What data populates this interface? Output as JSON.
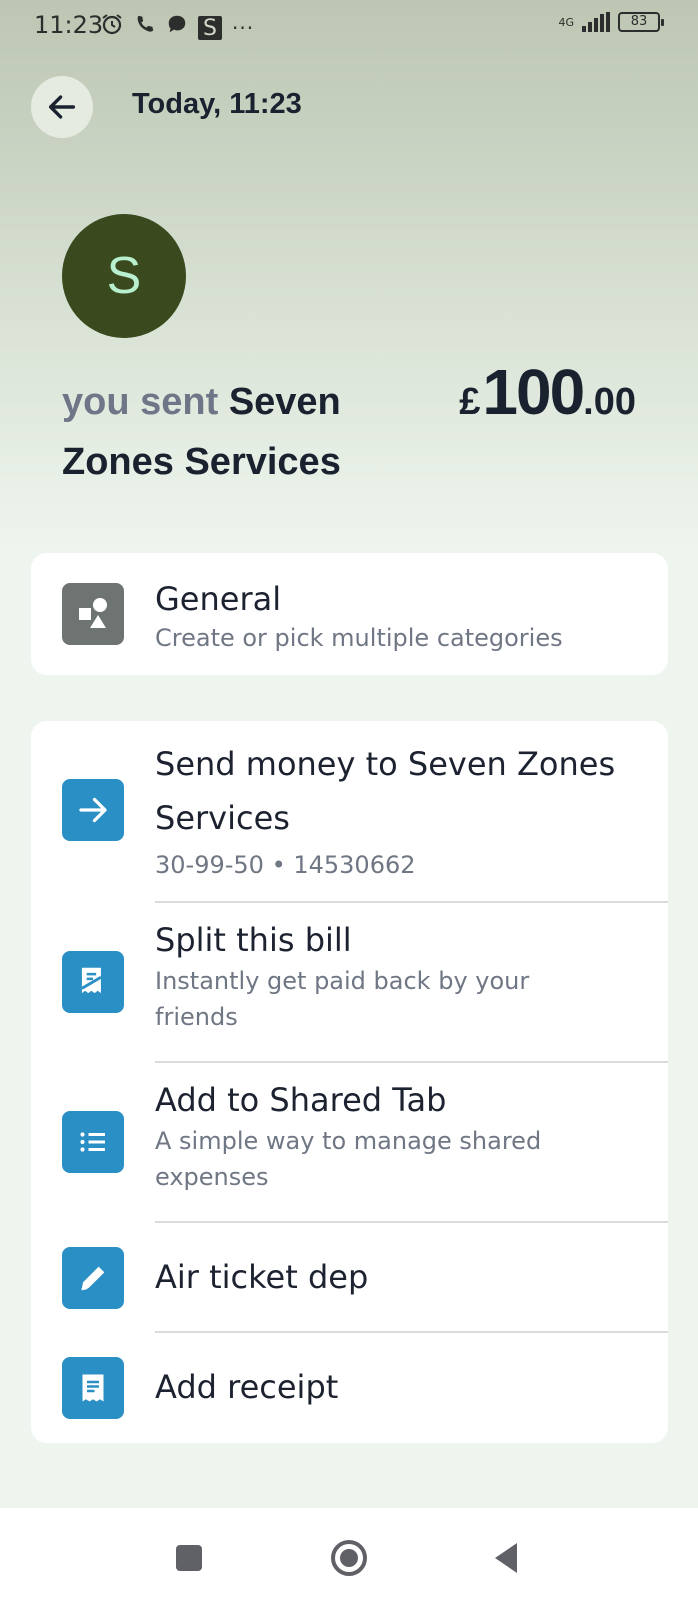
{
  "status_bar": {
    "time": "11:23",
    "network": "4G",
    "battery": "83",
    "icons": [
      "alarm-icon",
      "phone-icon",
      "chat-icon",
      "s-app-icon",
      "more-icon"
    ]
  },
  "header": {
    "title": "Today, 11:23"
  },
  "transaction": {
    "avatar_letter": "S",
    "avatar_color": "#3b4a1e",
    "prefix": "you sent",
    "recipient": "Seven Zones Services",
    "currency": "£",
    "amount_whole": "100",
    "amount_decimal": ".00"
  },
  "category": {
    "title": "General",
    "subtitle": "Create or pick multiple categories",
    "icon": "shapes-icon"
  },
  "actions": [
    {
      "title": "Send money to Seven Zones Services",
      "subtitle": "30-99-50 • 14530662",
      "icon": "arrow-right-icon"
    },
    {
      "title": "Split this bill",
      "subtitle": "Instantly get paid back by your friends",
      "icon": "split-bill-icon"
    },
    {
      "title": "Add to Shared Tab",
      "subtitle": "A simple way to manage shared expenses",
      "icon": "list-icon"
    },
    {
      "title": "Air ticket dep",
      "subtitle": "",
      "icon": "pencil-icon"
    },
    {
      "title": "Add receipt",
      "subtitle": "",
      "icon": "receipt-icon"
    }
  ],
  "colors": {
    "accent_blue": "#2a8fc4",
    "category_grey": "#6d7472"
  }
}
